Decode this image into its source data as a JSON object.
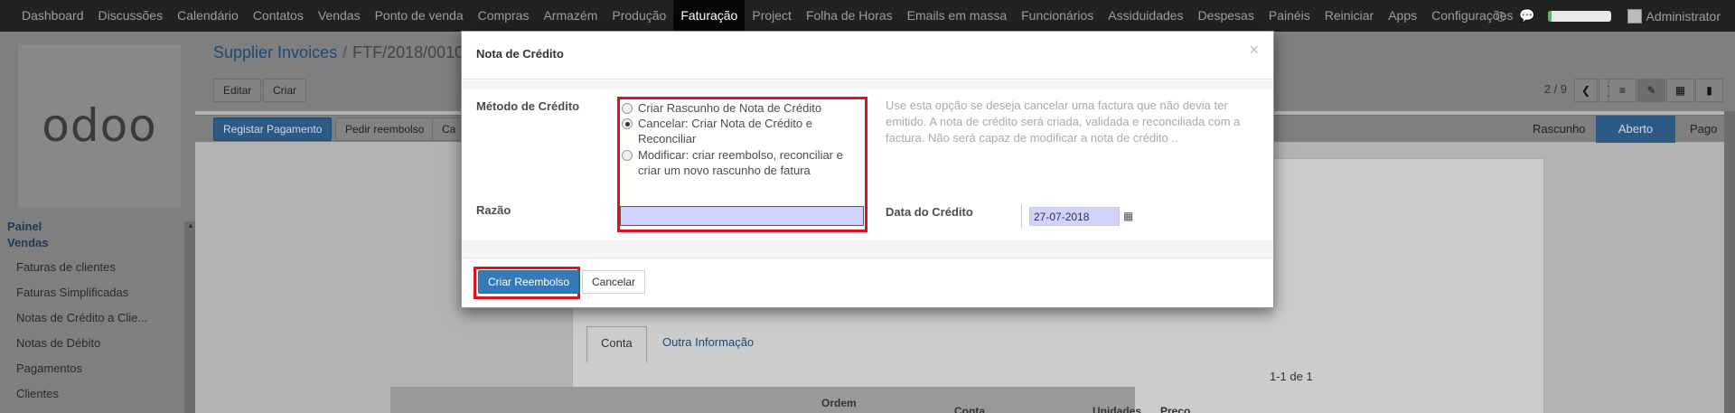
{
  "navbar": {
    "menu": [
      "Dashboard",
      "Discussões",
      "Calendário",
      "Contatos",
      "Vendas",
      "Ponto de venda",
      "Compras",
      "Armazém",
      "Produção",
      "Faturação",
      "Project",
      "Folha de Horas",
      "Emails em massa",
      "Funcionários",
      "Assiduidades",
      "Despesas",
      "Painéis",
      "Reiniciar",
      "Apps",
      "Configurações"
    ],
    "active_index": 9,
    "user": "Administrator",
    "progress_fraction": 0.06,
    "progress_color": "#5cb85c"
  },
  "sidebar": {
    "logo": "odoo",
    "section_1": "Painel",
    "section_2": "Vendas",
    "items": [
      "Faturas de clientes",
      "Faturas Simplificadas",
      "Notas de Crédito a Clie...",
      "Notas de Débito",
      "Pagamentos",
      "Clientes"
    ]
  },
  "control_panel": {
    "breadcrumb_link": "Supplier Invoices",
    "breadcrumb_current": "FTF/2018/0010",
    "edit_label": "Editar",
    "create_label": "Criar",
    "pager": "2 / 9",
    "register_payment": "Registar Pagamento",
    "ask_refund": "Pedir reembolso",
    "cancel_partial": "Ca"
  },
  "statusbar": {
    "stages": [
      "Rascunho",
      "Aberto",
      "Pago"
    ],
    "active_index": 1
  },
  "sheet": {
    "tab_account": "Conta",
    "tab_other": "Outra Informação",
    "count": "1-1 de 1",
    "columns": [
      "Ordem",
      "Conta",
      "Unidades",
      "Preço"
    ]
  },
  "modal": {
    "title": "Nota de Crédito",
    "method_label": "Método de Crédito",
    "options": [
      {
        "lines": [
          "Criar Rascunho de Nota de Crédito"
        ],
        "checked": false
      },
      {
        "lines": [
          "Cancelar: Criar Nota de Crédito e",
          "Reconciliar"
        ],
        "checked": true
      },
      {
        "lines": [
          "Modificar: criar reembolso, reconciliar e",
          "criar um novo rascunho de fatura"
        ],
        "checked": false
      }
    ],
    "help": "Use esta opção se deseja cancelar uma factura que não devia ter emitido. A nota de crédito será criada, validada e reconciliada com a factura. Não será capaz de modificar a nota de crédito ..",
    "reason_label": "Razão",
    "reason_value": "",
    "date_label": "Data do Crédito",
    "date_value": "27-07-2018",
    "primary_button": "Criar Reembolso",
    "cancel_button": "Cancelar",
    "highlight_color": "#e0101e"
  }
}
